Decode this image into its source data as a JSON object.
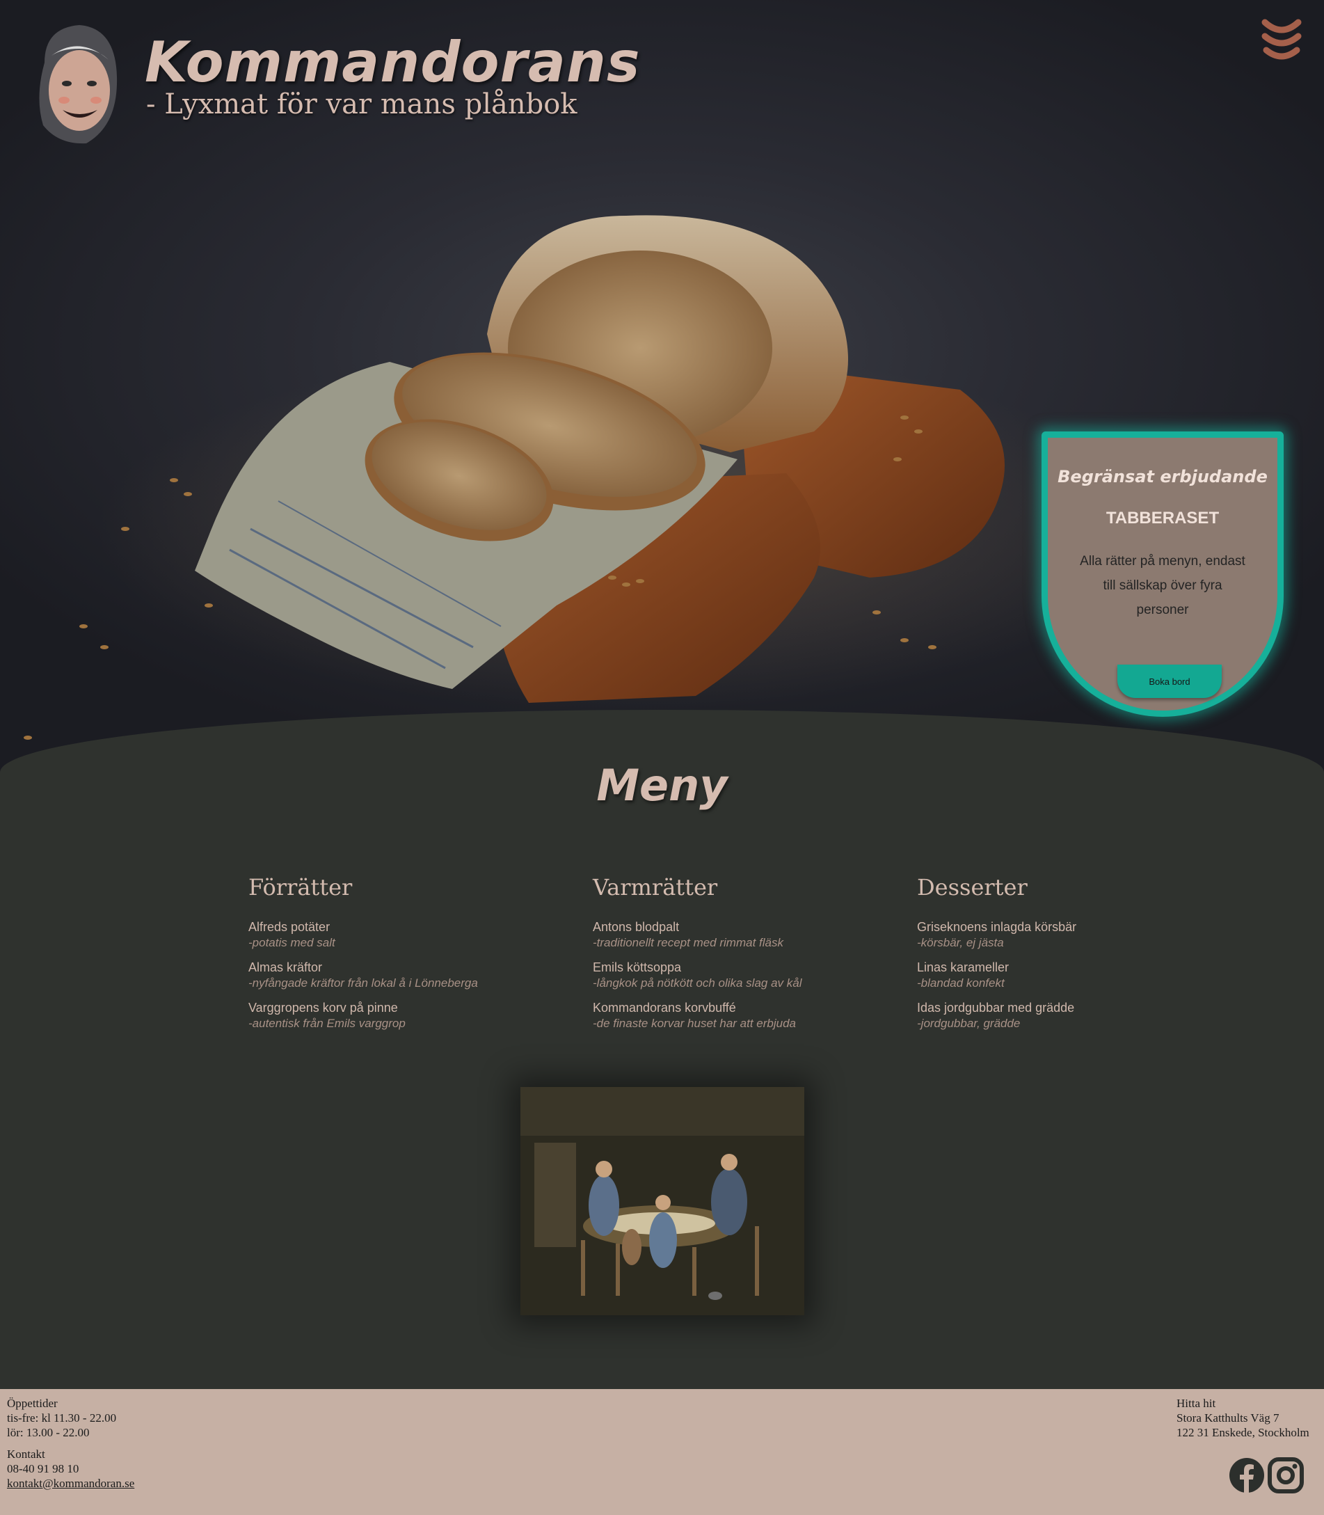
{
  "brand": {
    "title": "Kommandorans",
    "tagline": "- Lyxmat för var mans plånbok"
  },
  "offer": {
    "heading": "Begränsat erbjudande",
    "name": "TABBERASET",
    "description": "Alla rätter på menyn, endast till sällskap över fyra personer",
    "button_label": "Boka bord"
  },
  "menu": {
    "title": "Meny",
    "columns": [
      {
        "heading": "Förrätter",
        "dishes": [
          {
            "name": "Alfreds potäter",
            "desc": "-potatis med salt"
          },
          {
            "name": "Almas kräftor",
            "desc": "-nyfångade kräftor från lokal å i Lönneberga"
          },
          {
            "name": "Varggropens korv på pinne",
            "desc": "-autentisk från Emils varggrop"
          }
        ]
      },
      {
        "heading": "Varmrätter",
        "dishes": [
          {
            "name": "Antons blodpalt",
            "desc": "-traditionellt recept med rimmat fläsk"
          },
          {
            "name": "Emils köttsoppa",
            "desc": "-långkok på nötkött och olika slag av kål"
          },
          {
            "name": "Kommandorans korvbuffé",
            "desc": "-de finaste korvar huset har att erbjuda"
          }
        ]
      },
      {
        "heading": "Desserter",
        "dishes": [
          {
            "name": "Griseknoens inlagda körsbär",
            "desc": "-körsbär, ej jästa"
          },
          {
            "name": "Linas karameller",
            "desc": "-blandad konfekt"
          },
          {
            "name": "Idas jordgubbar med grädde",
            "desc": "-jordgubbar, grädde"
          }
        ]
      }
    ]
  },
  "footer": {
    "hours_title": "Öppettider",
    "hours_weekday": "tis-fre: kl 11.30 - 22.00",
    "hours_saturday": "lör: 13.00 - 22.00",
    "contact_title": "Kontakt",
    "phone": "08-40 91 98 10",
    "email": "kontakt@kommandoran.se",
    "find_title": "Hitta hit",
    "address_line1": "Stora Katthults Väg 7",
    "address_line2": "122 31 Enskede, Stockholm"
  },
  "icons": {
    "menu_toggle": "sausage-menu-icon",
    "facebook": "facebook-icon",
    "instagram": "instagram-icon"
  },
  "colors": {
    "accent_teal": "#16b09a",
    "brand_text": "#d6bcb0",
    "menu_background": "#2f322e",
    "footer_background": "#c6b0a4"
  }
}
